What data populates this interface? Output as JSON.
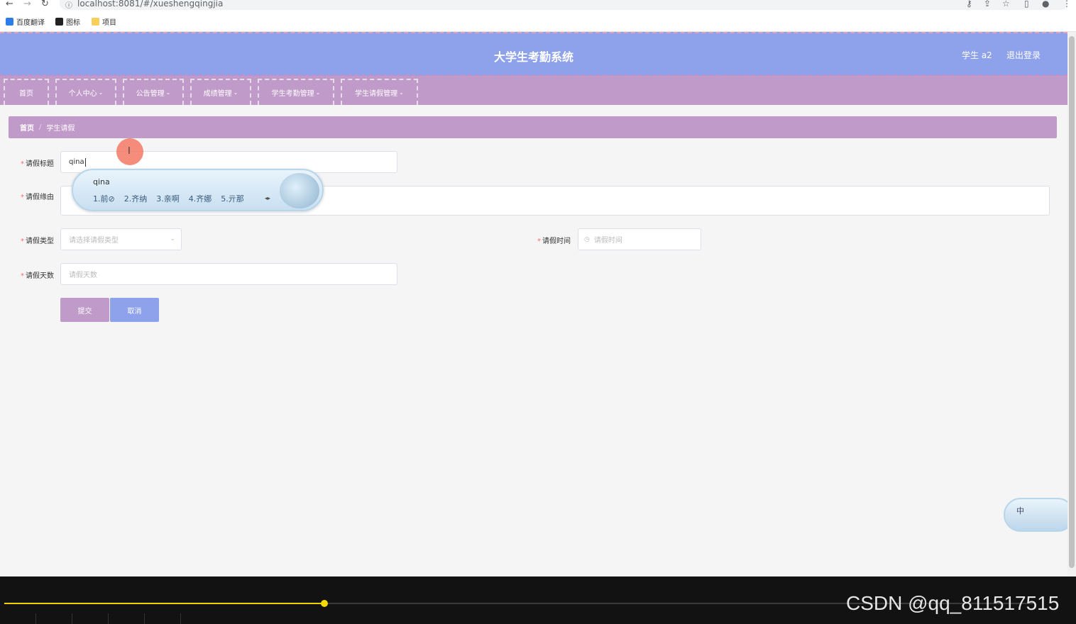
{
  "browser": {
    "url": "localhost:8081/#/xueshengqingjia",
    "bookmarks": [
      "百度翻译",
      "图标",
      "项目"
    ]
  },
  "header": {
    "title": "大学生考勤系统",
    "user": "学生 a2",
    "logout": "退出登录"
  },
  "menu": {
    "items": [
      {
        "label": "首页"
      },
      {
        "label": "个人中心"
      },
      {
        "label": "公告管理"
      },
      {
        "label": "成绩管理"
      },
      {
        "label": "学生考勤管理"
      },
      {
        "label": "学生请假管理"
      }
    ]
  },
  "breadcrumb": {
    "home": "首页",
    "sep": "/",
    "current": "学生请假"
  },
  "form": {
    "title_label": "请假标题",
    "title_value": "qina",
    "reason_label": "请假缘由",
    "type_label": "请假类型",
    "type_placeholder": "请选择请假类型",
    "time_label": "请假时间",
    "time_placeholder": "请假时间",
    "days_label": "请假天数",
    "days_placeholder": "请假天数",
    "submit": "提交",
    "cancel": "取消",
    "required_mark": "*"
  },
  "ime": {
    "composition": "qina",
    "candidates": [
      "1.前⊘",
      "2.齐纳",
      "3.亲啊",
      "4.齐娜",
      "5.亓那"
    ],
    "float_label": "中"
  },
  "player": {
    "watermark": "CSDN @qq_811517515",
    "progress_fraction": 0.311
  },
  "colors": {
    "header": "#8ea2ec",
    "menu": "#c09ac8",
    "submit": "#c09ac8",
    "cancel": "#8ea2ec"
  }
}
